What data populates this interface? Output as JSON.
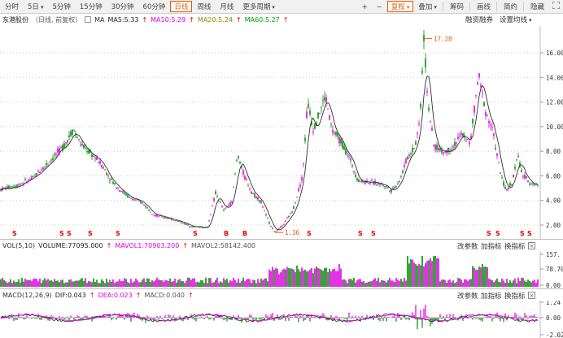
{
  "toolbar": {
    "periods": [
      {
        "label": "分时",
        "active": false
      },
      {
        "label": "5日",
        "active": false,
        "dropdown": true
      },
      {
        "label": "5分钟",
        "active": false
      },
      {
        "label": "15分钟",
        "active": false
      },
      {
        "label": "30分钟",
        "active": false
      },
      {
        "label": "60分钟",
        "active": false
      },
      {
        "label": "日线",
        "active": true
      },
      {
        "label": "周线",
        "active": false
      },
      {
        "label": "月线",
        "active": false
      },
      {
        "label": "更多周期",
        "active": false,
        "dropdown": true
      }
    ],
    "zoom_in": "+",
    "zoom_out": "−",
    "fq_label": "复权",
    "overlay_label": "叠加",
    "chip_label": "筹码",
    "draw_label": "画线",
    "simple_label": "简约",
    "hide_label": "隐藏",
    "expand_icon": "expand-icon"
  },
  "info": {
    "name": "东港股份",
    "suffix": "（日线, 前复权）",
    "ma_label": "MA",
    "ma5": "MA5:5.33",
    "ma10": "MA10:5.29",
    "ma20": "MA20:5.24",
    "ma60": "MA60:5.27",
    "margin_label": "融资融券",
    "ma_settings_label": "设置均线",
    "colors": {
      "ma5": "#222222",
      "ma10": "#e000e0",
      "ma20": "#888800",
      "ma60": "#00a000"
    }
  },
  "main_chart": {
    "y_ticks": [
      "16.00",
      "14.00",
      "12.00",
      "10.00",
      "8.00",
      "6.00",
      "4.00",
      "2.00"
    ],
    "high_label": "17.28",
    "low_label": "1.36",
    "s_marker": "S",
    "b_marker": "B",
    "colors": {
      "up": "#e00000",
      "down": "#009000",
      "price": "#e000e0",
      "ma": "#303030",
      "marker": "#e00000"
    }
  },
  "vol": {
    "title": "VOL(5,10)",
    "volume": "VOLUME:77095.000",
    "mavol1": "MAVOL1:70903.200",
    "mavol2": "MAVOL2:58142.400",
    "y_ticks": [
      "157.",
      "78.70",
      "0.00"
    ],
    "change_param": "改参数",
    "add_indicator": "加指标",
    "switch_indicator": "换指标",
    "close": "×"
  },
  "macd": {
    "title": "MACD(12,26,9)",
    "dif": "DIF:0.043",
    "dea": "DEA:0.023",
    "macd": "MACD:0.040",
    "y_ticks": [
      "1.24",
      "0.00",
      "-2.02"
    ],
    "change_param": "改参数",
    "add_indicator": "加指标",
    "switch_indicator": "换指标",
    "close": "×"
  }
}
